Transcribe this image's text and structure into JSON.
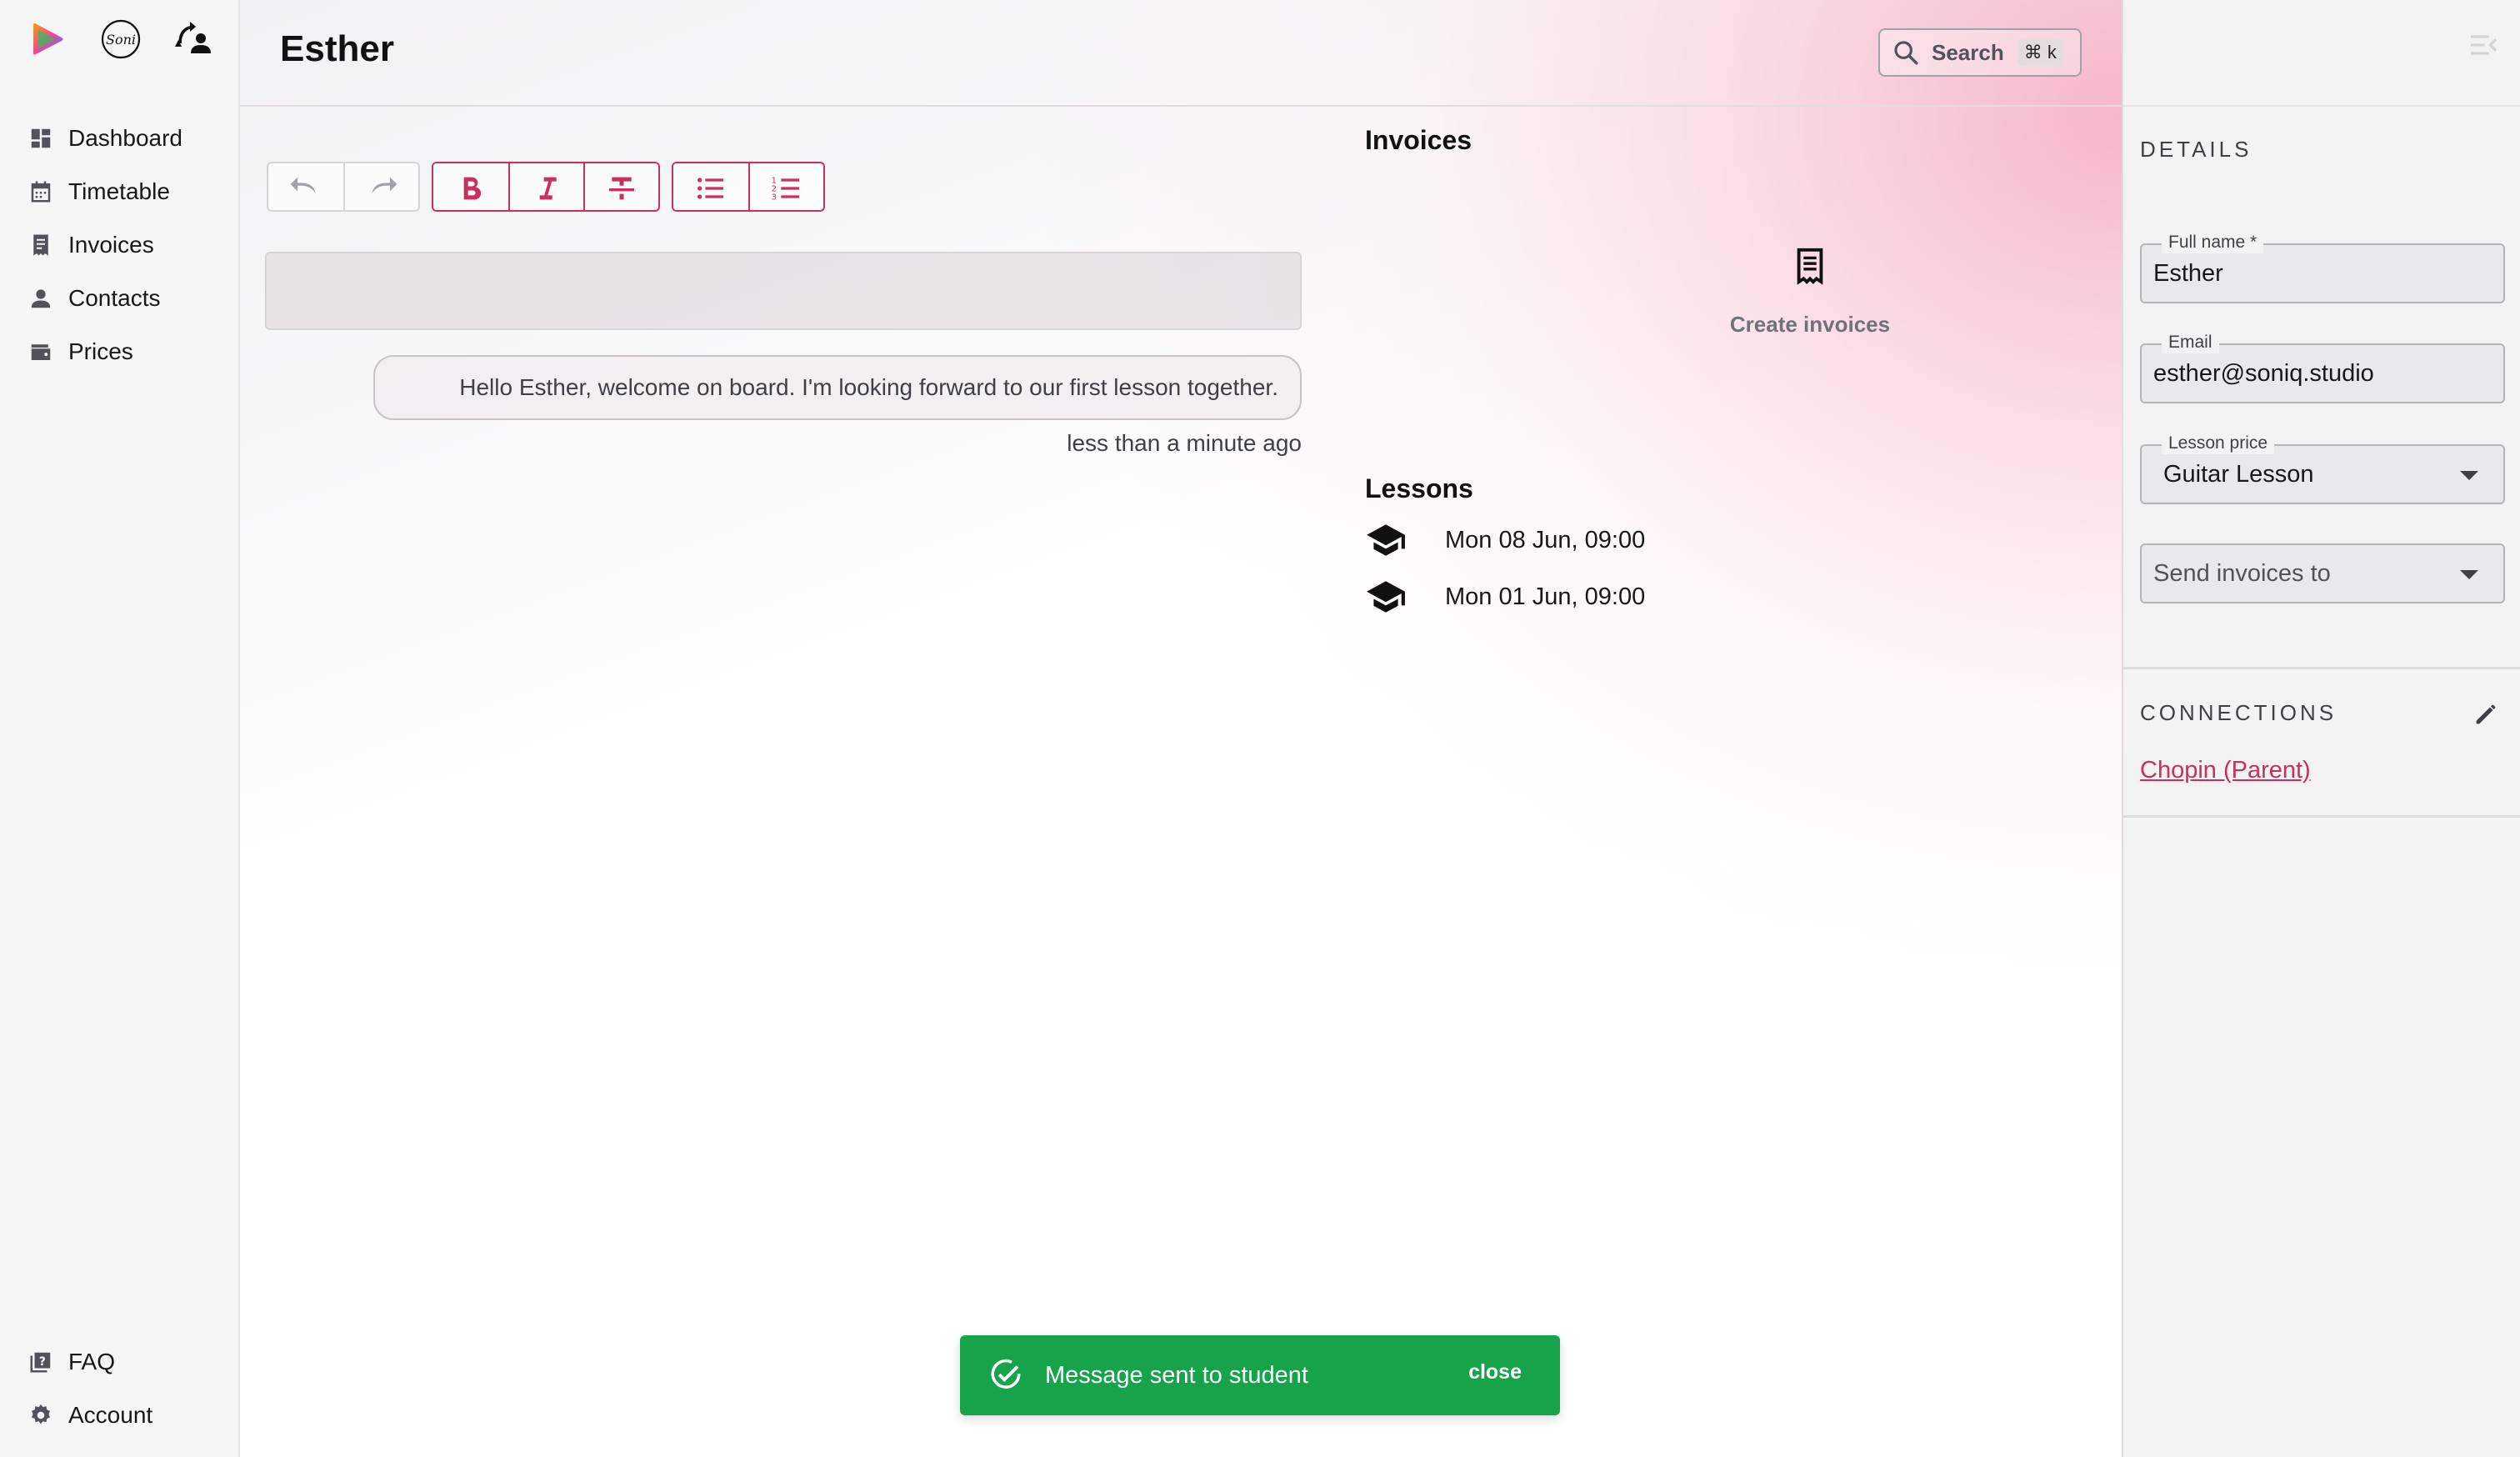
{
  "sidebar": {
    "logos": [
      "app-logo-icon",
      "soni-logo-icon",
      "switch-account-icon"
    ],
    "logo_text": "Soni",
    "nav": [
      {
        "label": "Dashboard",
        "icon": "dashboard-icon"
      },
      {
        "label": "Timetable",
        "icon": "calendar-icon"
      },
      {
        "label": "Invoices",
        "icon": "receipt-icon"
      },
      {
        "label": "Contacts",
        "icon": "person-icon"
      },
      {
        "label": "Prices",
        "icon": "wallet-icon"
      }
    ],
    "bottom_nav": [
      {
        "label": "FAQ",
        "icon": "help-book-icon"
      },
      {
        "label": "Account",
        "icon": "gear-icon"
      }
    ]
  },
  "header": {
    "title": "Esther",
    "search_label": "Search",
    "search_shortcut": "⌘ k"
  },
  "editor": {
    "toolbar": [
      "undo",
      "redo",
      "bold",
      "italic",
      "strikethrough",
      "bullet-list",
      "numbered-list"
    ],
    "placeholder": ""
  },
  "messages": [
    {
      "text": "Hello Esther, welcome on board. I'm looking forward to our first lesson together.",
      "time": "less than a minute ago"
    }
  ],
  "invoices": {
    "title": "Invoices",
    "create_label": "Create invoices"
  },
  "lessons": {
    "title": "Lessons",
    "items": [
      {
        "label": "Mon 08 Jun, 09:00"
      },
      {
        "label": "Mon 01 Jun, 09:00"
      }
    ]
  },
  "details": {
    "heading": "DETAILS",
    "full_name": {
      "label": "Full name *",
      "value": "Esther"
    },
    "email": {
      "label": "Email",
      "value": "esther@soniq.studio"
    },
    "lesson_price": {
      "label": "Lesson price",
      "value": "Guitar Lesson"
    },
    "send_invoices_to": {
      "placeholder": "Send invoices to"
    }
  },
  "connections": {
    "heading": "CONNECTIONS",
    "items": [
      {
        "label": "Chopin (Parent)"
      }
    ]
  },
  "toast": {
    "message": "Message sent to student",
    "close_label": "close"
  },
  "colors": {
    "accent": "#c9305e",
    "success": "#16a34a",
    "sidebar_bg": "#f6f6f7"
  }
}
